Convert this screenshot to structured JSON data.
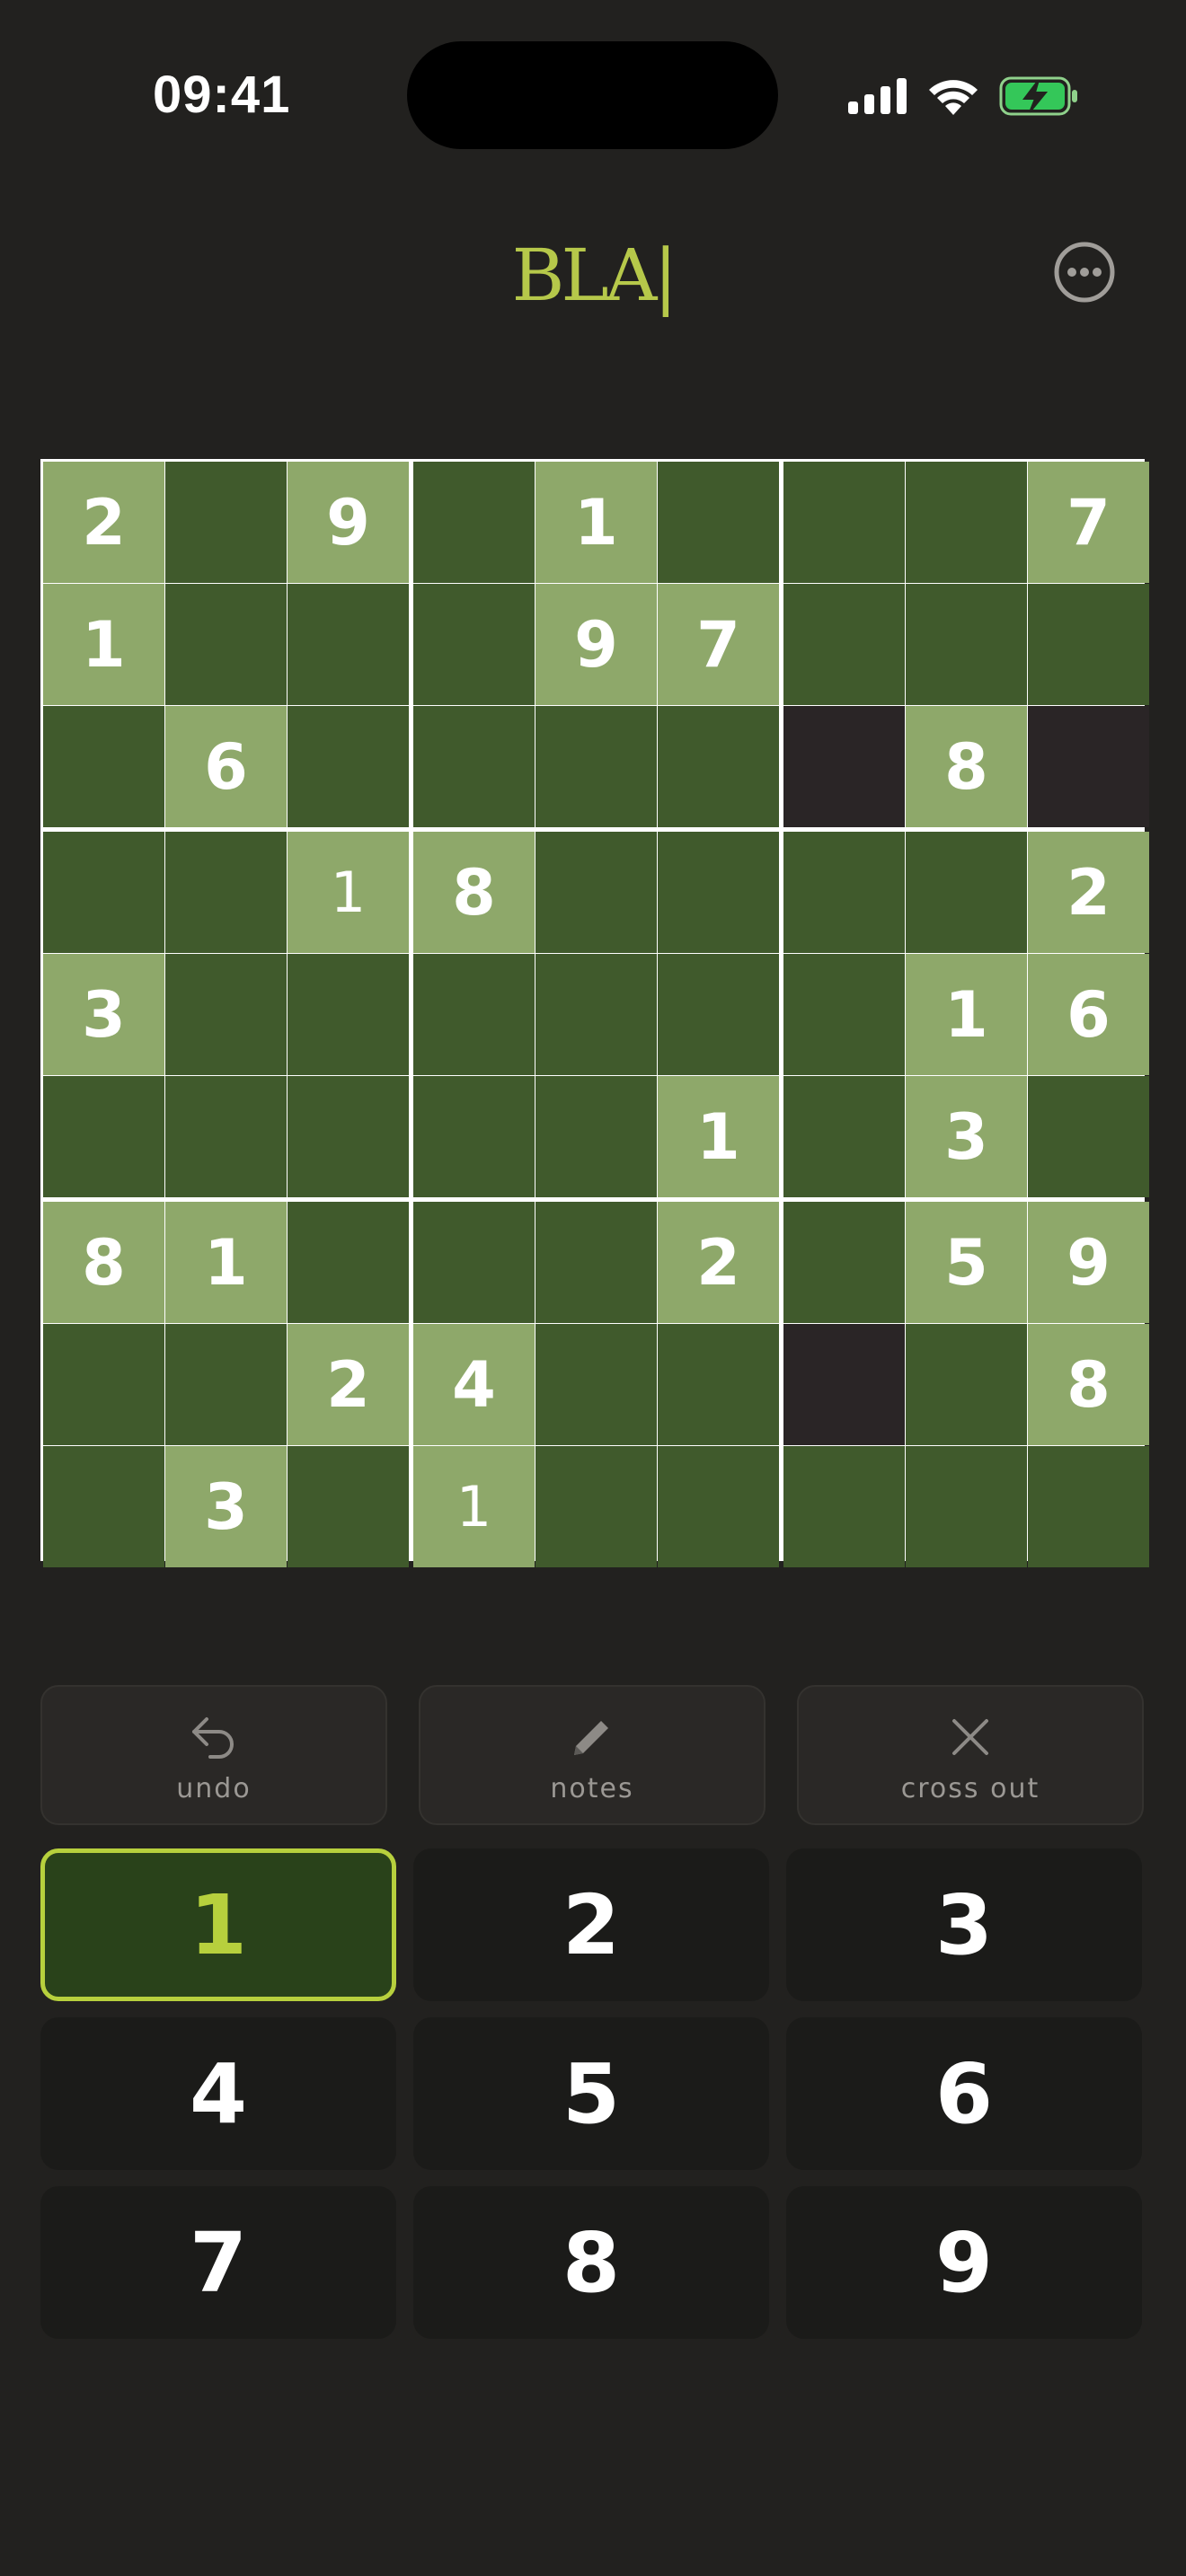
{
  "status_bar": {
    "time": "09:41"
  },
  "header": {
    "logo": "BLA|"
  },
  "board": {
    "cells": [
      [
        {
          "v": "2",
          "s": "light"
        },
        {
          "v": "",
          "s": "dark"
        },
        {
          "v": "9",
          "s": "light"
        },
        {
          "v": "",
          "s": "dark"
        },
        {
          "v": "1",
          "s": "light"
        },
        {
          "v": "",
          "s": "dark"
        },
        {
          "v": "",
          "s": "dark"
        },
        {
          "v": "",
          "s": "dark"
        },
        {
          "v": "7",
          "s": "light"
        }
      ],
      [
        {
          "v": "1",
          "s": "light"
        },
        {
          "v": "",
          "s": "dark"
        },
        {
          "v": "",
          "s": "dark"
        },
        {
          "v": "",
          "s": "dark"
        },
        {
          "v": "9",
          "s": "light"
        },
        {
          "v": "7",
          "s": "light"
        },
        {
          "v": "",
          "s": "dark"
        },
        {
          "v": "",
          "s": "dark"
        },
        {
          "v": "",
          "s": "dark"
        }
      ],
      [
        {
          "v": "",
          "s": "dark"
        },
        {
          "v": "6",
          "s": "light"
        },
        {
          "v": "",
          "s": "dark"
        },
        {
          "v": "",
          "s": "dark"
        },
        {
          "v": "",
          "s": "dark"
        },
        {
          "v": "",
          "s": "dark"
        },
        {
          "v": "",
          "s": "black"
        },
        {
          "v": "8",
          "s": "light"
        },
        {
          "v": "",
          "s": "black"
        }
      ],
      [
        {
          "v": "",
          "s": "dark"
        },
        {
          "v": "",
          "s": "dark"
        },
        {
          "v": "1",
          "s": "light",
          "note": true
        },
        {
          "v": "8",
          "s": "light"
        },
        {
          "v": "",
          "s": "dark"
        },
        {
          "v": "",
          "s": "dark"
        },
        {
          "v": "",
          "s": "dark"
        },
        {
          "v": "",
          "s": "dark"
        },
        {
          "v": "2",
          "s": "light"
        }
      ],
      [
        {
          "v": "3",
          "s": "light"
        },
        {
          "v": "",
          "s": "dark"
        },
        {
          "v": "",
          "s": "dark"
        },
        {
          "v": "",
          "s": "dark"
        },
        {
          "v": "",
          "s": "dark"
        },
        {
          "v": "",
          "s": "dark"
        },
        {
          "v": "",
          "s": "dark"
        },
        {
          "v": "1",
          "s": "light"
        },
        {
          "v": "6",
          "s": "light"
        }
      ],
      [
        {
          "v": "",
          "s": "dark"
        },
        {
          "v": "",
          "s": "dark"
        },
        {
          "v": "",
          "s": "dark"
        },
        {
          "v": "",
          "s": "dark"
        },
        {
          "v": "",
          "s": "dark"
        },
        {
          "v": "1",
          "s": "light"
        },
        {
          "v": "",
          "s": "dark"
        },
        {
          "v": "3",
          "s": "light"
        },
        {
          "v": "",
          "s": "dark"
        }
      ],
      [
        {
          "v": "8",
          "s": "light"
        },
        {
          "v": "1",
          "s": "light"
        },
        {
          "v": "",
          "s": "dark"
        },
        {
          "v": "",
          "s": "dark"
        },
        {
          "v": "",
          "s": "dark"
        },
        {
          "v": "2",
          "s": "light"
        },
        {
          "v": "",
          "s": "dark"
        },
        {
          "v": "5",
          "s": "light"
        },
        {
          "v": "9",
          "s": "light"
        }
      ],
      [
        {
          "v": "",
          "s": "dark"
        },
        {
          "v": "",
          "s": "dark"
        },
        {
          "v": "2",
          "s": "light"
        },
        {
          "v": "4",
          "s": "light"
        },
        {
          "v": "",
          "s": "dark"
        },
        {
          "v": "",
          "s": "dark"
        },
        {
          "v": "",
          "s": "black"
        },
        {
          "v": "",
          "s": "dark"
        },
        {
          "v": "8",
          "s": "light"
        }
      ],
      [
        {
          "v": "",
          "s": "dark"
        },
        {
          "v": "3",
          "s": "light"
        },
        {
          "v": "",
          "s": "dark"
        },
        {
          "v": "1",
          "s": "light",
          "note": true
        },
        {
          "v": "",
          "s": "dark"
        },
        {
          "v": "",
          "s": "dark"
        },
        {
          "v": "",
          "s": "dark"
        },
        {
          "v": "",
          "s": "dark"
        },
        {
          "v": "",
          "s": "dark"
        }
      ]
    ]
  },
  "tools": {
    "undo_label": "undo",
    "notes_label": "notes",
    "cross_out_label": "cross out"
  },
  "keypad": {
    "keys": [
      "1",
      "2",
      "3",
      "4",
      "5",
      "6",
      "7",
      "8",
      "9"
    ],
    "selected": "1"
  },
  "colors": {
    "accent": "#b7d03d",
    "cell_given": "#8ea86a",
    "cell_empty": "#405a2c",
    "cell_blocked": "#2a2526"
  }
}
